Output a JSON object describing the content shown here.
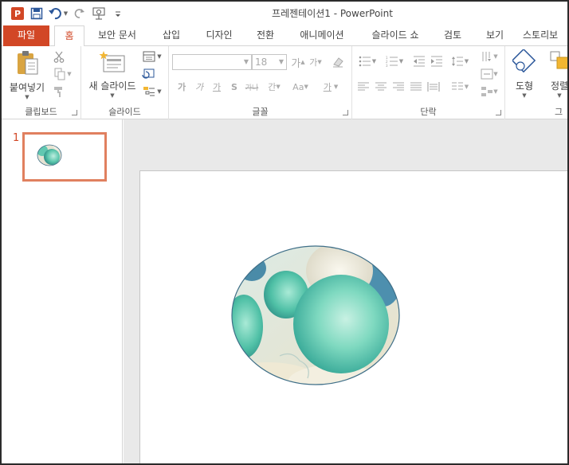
{
  "window": {
    "title": "프레젠테이션1 - PowerPoint"
  },
  "qat": {
    "app_icon": "powerpoint-icon",
    "save_icon": "save-icon",
    "undo_icon": "undo-icon",
    "redo_icon": "redo-icon",
    "present_icon": "present-from-beginning-icon",
    "customize_icon": "customize-qat-icon"
  },
  "tabs": [
    {
      "label": "파일"
    },
    {
      "label": "홈"
    },
    {
      "label": "보안 문서"
    },
    {
      "label": "삽입"
    },
    {
      "label": "디자인"
    },
    {
      "label": "전환"
    },
    {
      "label": "애니메이션"
    },
    {
      "label": "슬라이드 쇼"
    },
    {
      "label": "검토"
    },
    {
      "label": "보기"
    },
    {
      "label": "스토리보"
    }
  ],
  "ribbon": {
    "clipboard": {
      "group_label": "클립보드",
      "paste_label": "붙여넣기"
    },
    "slides": {
      "group_label": "슬라이드",
      "new_slide_label": "새 슬라이드"
    },
    "font": {
      "group_label": "글꼴",
      "font_name": "",
      "font_size": "18",
      "bold": "가",
      "italic": "가",
      "underline": "가",
      "shadow": "S",
      "strike": "가나",
      "spacing": "간",
      "case": "Aa",
      "color": "가",
      "grow": "가",
      "shrink": "가"
    },
    "paragraph": {
      "group_label": "단락"
    },
    "drawing": {
      "group_label": "그",
      "shapes_label": "도형",
      "arrange_label": "정렬"
    }
  },
  "thumbnails": [
    {
      "number": "1"
    }
  ],
  "colors": {
    "accent": "#d24726",
    "thumb_border": "#e0805f"
  }
}
